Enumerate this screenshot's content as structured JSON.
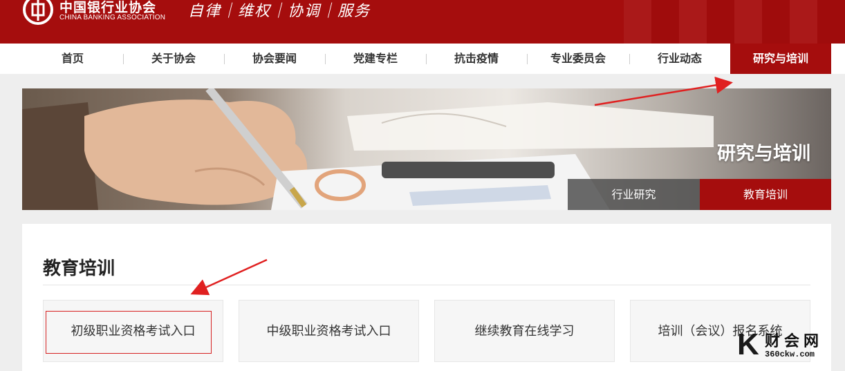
{
  "header": {
    "org_name_cn": "中国银行业协会",
    "org_name_en": "CHINA BANKING ASSOCIATION",
    "slogan": "自律｜维权｜协调｜服务"
  },
  "nav": {
    "items": [
      {
        "label": "首页"
      },
      {
        "label": "关于协会"
      },
      {
        "label": "协会要闻"
      },
      {
        "label": "党建专栏"
      },
      {
        "label": "抗击疫情"
      },
      {
        "label": "专业委员会"
      },
      {
        "label": "行业动态"
      },
      {
        "label": "研究与培训",
        "active": true
      }
    ]
  },
  "banner": {
    "title": "研究与培训",
    "tabs": [
      {
        "label": "行业研究"
      },
      {
        "label": "教育培训",
        "active": true
      }
    ]
  },
  "section": {
    "title": "教育培训",
    "cards": [
      {
        "label": "初级职业资格考试入口",
        "highlighted": true
      },
      {
        "label": "中级职业资格考试入口"
      },
      {
        "label": "继续教育在线学习"
      },
      {
        "label": "培训（会议）报名系统"
      }
    ]
  },
  "watermark": {
    "letter": "K",
    "name_cn": "财会网",
    "url": "360ckw.com"
  },
  "colors": {
    "brand_red": "#a50d0d",
    "highlight_red": "#d62020"
  }
}
